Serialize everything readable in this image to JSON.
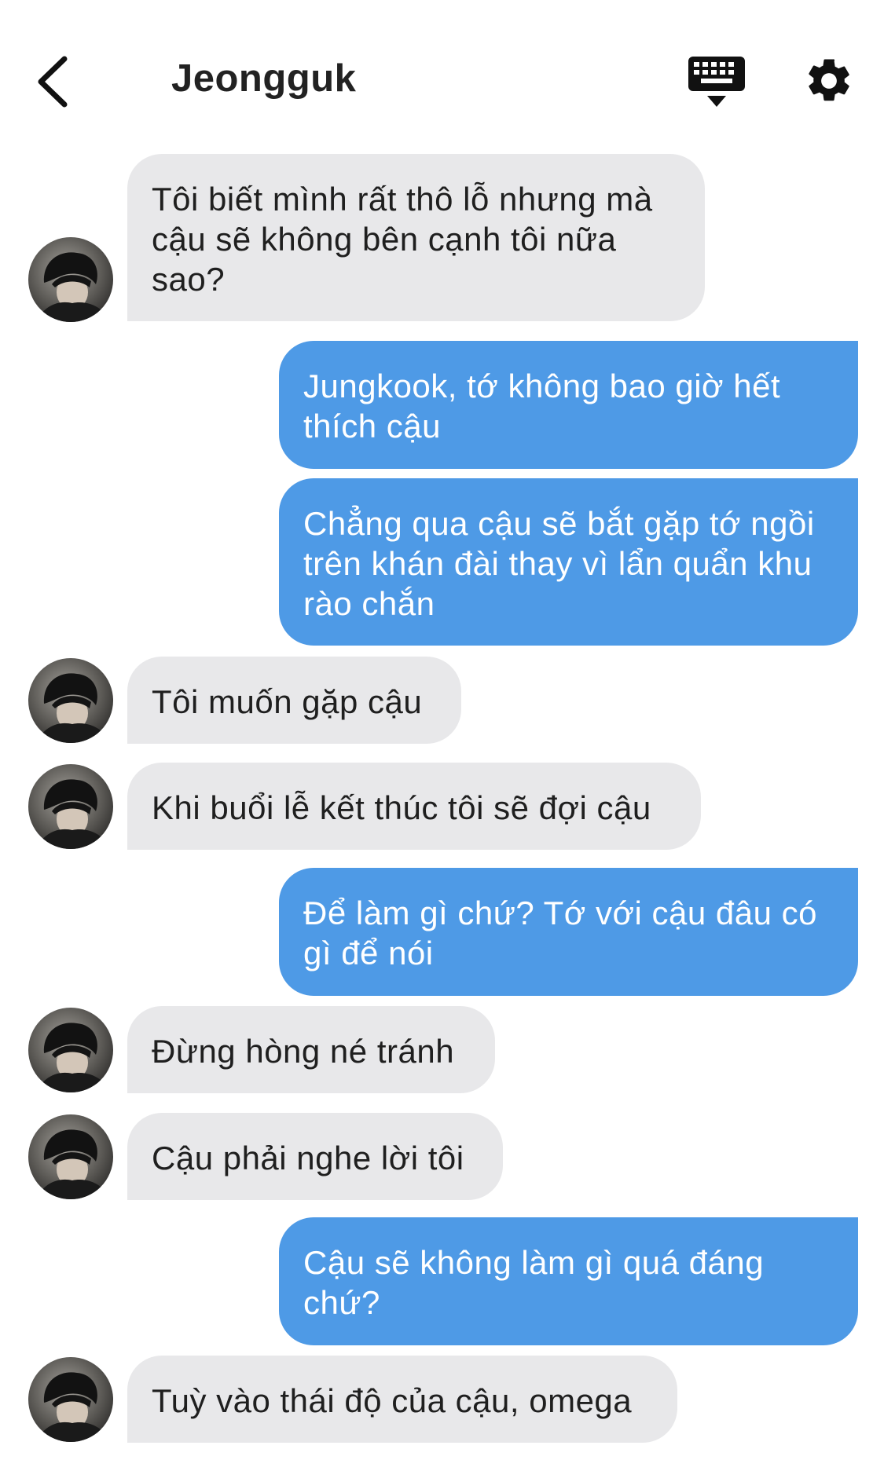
{
  "header": {
    "title": "Jeongguk",
    "back_icon": "chevron-left-icon",
    "keyboard_icon": "keyboard-icon",
    "settings_icon": "gear-icon"
  },
  "messages": [
    {
      "side": "in",
      "text": "Tôi biết mình rất thô lỗ nhưng mà cậu sẽ không bên cạnh tôi nữa sao?"
    },
    {
      "side": "out",
      "text": "Jungkook, tớ không bao giờ hết thích cậu"
    },
    {
      "side": "out",
      "text": "Chẳng qua cậu sẽ bắt gặp tớ ngồi trên khán đài thay vì lẩn quẩn khu rào chắn"
    },
    {
      "side": "in",
      "text": "Tôi muốn gặp cậu"
    },
    {
      "side": "in",
      "text": "Khi buổi lễ kết thúc tôi sẽ đợi cậu"
    },
    {
      "side": "out",
      "text": "Để làm gì chứ? Tớ với cậu đâu có gì để nói"
    },
    {
      "side": "in",
      "text": "Đừng hòng né tránh"
    },
    {
      "side": "in",
      "text": "Cậu phải nghe lời tôi"
    },
    {
      "side": "out",
      "text": "Cậu sẽ không làm gì quá đáng chứ?"
    },
    {
      "side": "in",
      "text": "Tuỳ vào thái độ của cậu, omega"
    }
  ],
  "colors": {
    "incoming_bubble": "#e8e8ea",
    "outgoing_bubble": "#4e9ae6",
    "title": "#222222"
  }
}
